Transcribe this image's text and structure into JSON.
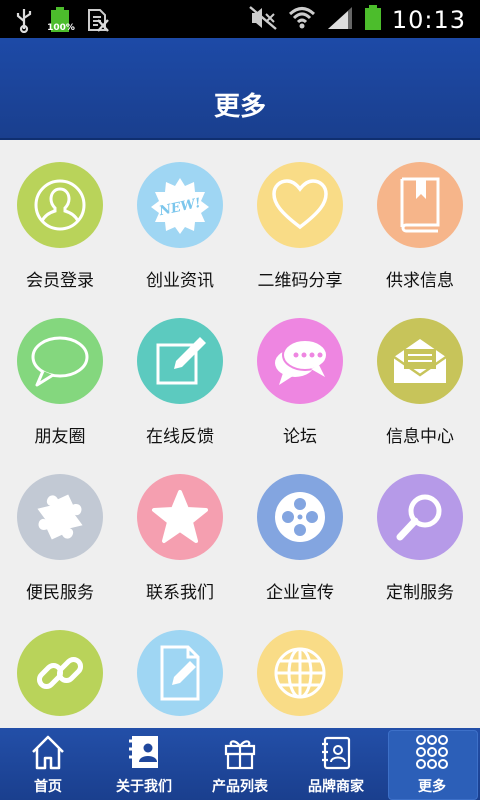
{
  "status": {
    "battery_level": "100%",
    "time": "10:13"
  },
  "header": {
    "title": "更多"
  },
  "items": [
    {
      "label": "会员登录",
      "icon": "user-icon",
      "color": "#b9d35a"
    },
    {
      "label": "创业资讯",
      "icon": "new-badge-icon",
      "color": "#9fd6f3"
    },
    {
      "label": "二维码分享",
      "icon": "heart-icon",
      "color": "#f9dc87"
    },
    {
      "label": "供求信息",
      "icon": "book-icon",
      "color": "#f6b58a"
    },
    {
      "label": "朋友圈",
      "icon": "speech-bubble-icon",
      "color": "#84d77e"
    },
    {
      "label": "在线反馈",
      "icon": "edit-icon",
      "color": "#5ccabf"
    },
    {
      "label": "论坛",
      "icon": "chat-bubbles-icon",
      "color": "#ee86e1"
    },
    {
      "label": "信息中心",
      "icon": "mail-icon",
      "color": "#c7c45a"
    },
    {
      "label": "便民服务",
      "icon": "puzzle-icon",
      "color": "#c2c9d4"
    },
    {
      "label": "联系我们",
      "icon": "star-icon",
      "color": "#f59fb0"
    },
    {
      "label": "企业宣传",
      "icon": "film-reel-icon",
      "color": "#83a5e0"
    },
    {
      "label": "定制服务",
      "icon": "search-icon",
      "color": "#b69ae8"
    },
    {
      "label": "",
      "icon": "link-icon",
      "color": "#b9d35a"
    },
    {
      "label": "",
      "icon": "document-edit-icon",
      "color": "#9fd6f3"
    },
    {
      "label": "",
      "icon": "globe-icon",
      "color": "#f9dc87"
    }
  ],
  "tabs": [
    {
      "label": "首页",
      "icon": "home-icon"
    },
    {
      "label": "关于我们",
      "icon": "contact-card-icon"
    },
    {
      "label": "产品列表",
      "icon": "gift-icon"
    },
    {
      "label": "品牌商家",
      "icon": "address-book-icon"
    },
    {
      "label": "更多",
      "icon": "grid-dots-icon",
      "active": true
    }
  ]
}
